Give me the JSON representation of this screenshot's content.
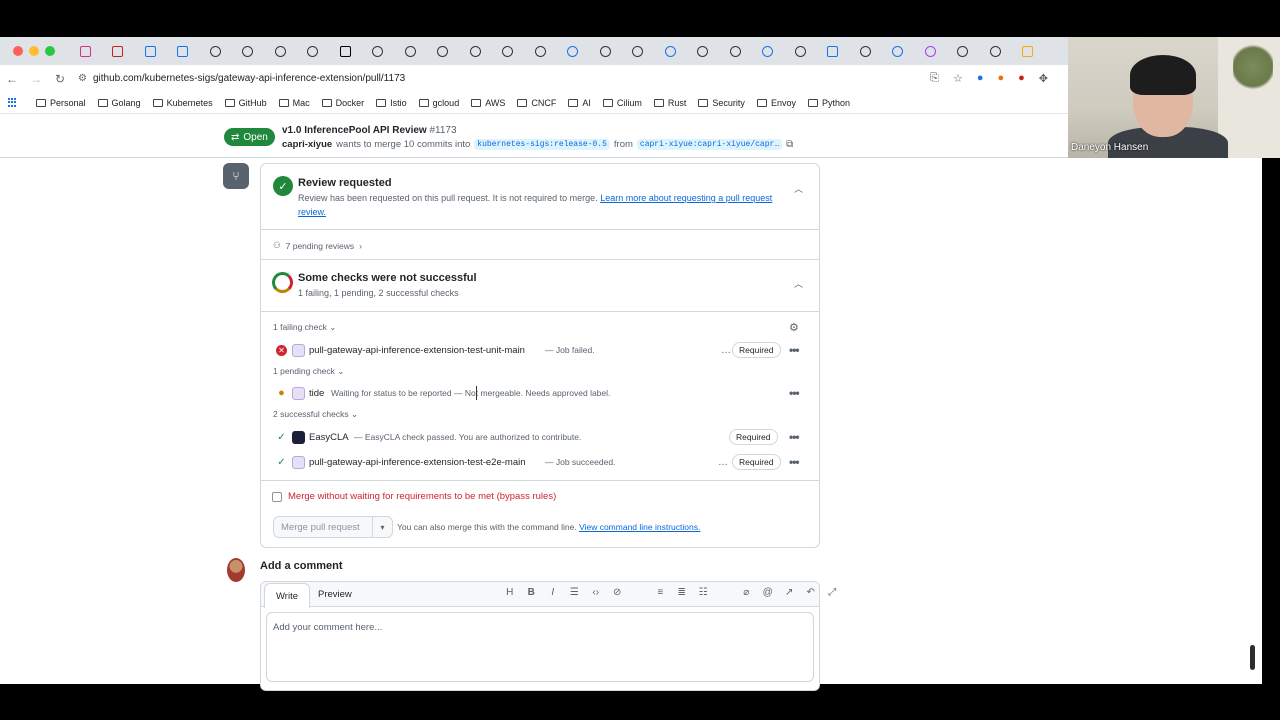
{
  "browser": {
    "url": "github.com/kubernetes-sigs/gateway-api-inference-extension/pull/1173",
    "bookmarks": [
      "Personal",
      "Golang",
      "Kubernetes",
      "GitHub",
      "Mac",
      "Docker",
      "Istio",
      "gcloud",
      "AWS",
      "CNCF",
      "AI",
      "Cilium",
      "Rust",
      "Security",
      "Envoy",
      "Python"
    ],
    "traffic_colors": [
      "#ff5f57",
      "#febc2e",
      "#28c840"
    ]
  },
  "video": {
    "name": "Daneyon Hansen"
  },
  "pr": {
    "state": "Open",
    "title": "v1.0 InferencePool API Review",
    "number": "#1173",
    "author": "capri-xiyue",
    "merge_text": "wants to merge 10 commits into",
    "base_branch": "kubernetes-sigs:release-0.5",
    "from_text": "from",
    "head_branch": "capri-xiyue:capri-xiyue/capr…"
  },
  "review": {
    "title": "Review requested",
    "desc": "Review has been requested on this pull request. It is not required to merge.",
    "link": "Learn more about requesting a pull request review.",
    "pending_reviews": "7 pending reviews"
  },
  "checks": {
    "title": "Some checks were not successful",
    "summary": "1 failing, 1 pending, 2 successful checks",
    "failing_label": "1 failing check",
    "pending_label": "1 pending check",
    "success_label": "2 successful checks",
    "items": [
      {
        "name": "pull-gateway-api-inference-extension-test-unit-main",
        "desc": "— Job failed.",
        "required": "Required"
      },
      {
        "name": "tide",
        "desc": "Waiting for status to be reported — Not mergeable. Needs approved label."
      },
      {
        "name": "EasyCLA",
        "desc": "— EasyCLA check passed. You are authorized to contribute.",
        "required": "Required"
      },
      {
        "name": "pull-gateway-api-inference-extension-test-e2e-main",
        "desc": "— Job succeeded.",
        "required": "Required"
      }
    ]
  },
  "merge": {
    "bypass_label": "Merge without waiting for requirements to be met (bypass rules)",
    "button": "Merge pull request",
    "cli_text": "You can also merge this with the command line.",
    "cli_link": "View command line instructions."
  },
  "comment": {
    "heading": "Add a comment",
    "tab_write": "Write",
    "tab_preview": "Preview",
    "placeholder": "Add your comment here..."
  }
}
